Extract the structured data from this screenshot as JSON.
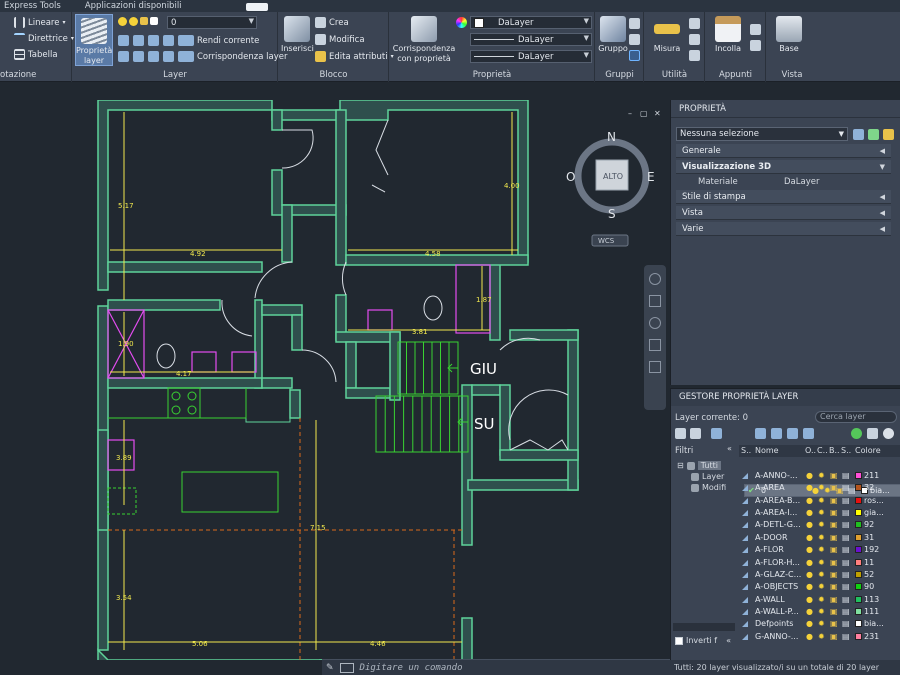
{
  "menu": {
    "items": [
      "Express Tools",
      "Applicazioni disponibili"
    ]
  },
  "ribbon": {
    "annotazione": {
      "items": [
        "Lineare",
        "Direttrice",
        "Tabella"
      ],
      "title": "otazione"
    },
    "layer": {
      "big_button": "Proprietà layer",
      "combo_value": "0",
      "items": [
        "Rendi corrente",
        "Corrispondenza layer"
      ],
      "title": "Layer"
    },
    "blocco": {
      "big_button": "Inserisci",
      "items": [
        "Crea",
        "Modifica",
        "Edita attributi"
      ],
      "title": "Blocco"
    },
    "proprieta": {
      "big_button": "Corrispondenza con proprietà",
      "combos": [
        "DaLayer",
        "DaLayer",
        "DaLayer"
      ],
      "title": "Proprietà"
    },
    "gruppi": {
      "big_button": "Gruppo",
      "title": "Gruppi"
    },
    "utilita": {
      "big_button": "Misura",
      "title": "Utilità"
    },
    "appunti": {
      "big_button": "Incolla",
      "title": "Appunti"
    },
    "vista": {
      "big_button": "Base",
      "title": "Vista"
    }
  },
  "viewcube": {
    "north": "N",
    "south": "S",
    "east": "E",
    "west": "O",
    "face": "ALTO",
    "wcs": "WCS"
  },
  "drawing": {
    "dims": [
      "5.17",
      "4.92",
      "4.00",
      "4.58",
      "1.87",
      "3.81",
      "1.90",
      "4.17",
      "3.89",
      "7.15",
      "3.54",
      "5.06",
      "4.46"
    ],
    "stair_up": "GIU",
    "stair_down": "SU"
  },
  "properties": {
    "title": "PROPRIETÀ",
    "selection": "Nessuna selezione",
    "sections": [
      "Generale",
      "Visualizzazione 3D",
      "Stile di stampa",
      "Vista",
      "Varie"
    ],
    "material_label": "Materiale",
    "material_value": "DaLayer"
  },
  "layer_manager": {
    "title": "GESTORE PROPRIETÀ LAYER",
    "current_layer": "Layer corrente: 0",
    "search_placeholder": "Cerca layer",
    "filters_label": "Filtri",
    "tree": [
      "Tutti",
      "Layer",
      "Modifi"
    ],
    "invert_label": "Inverti f",
    "columns": [
      "S..",
      "Nome",
      "O..",
      "C..",
      "B..",
      "S..",
      "Colore"
    ],
    "rows": [
      {
        "name": "0",
        "color_name": "bia...",
        "color": "#ffffff"
      },
      {
        "name": "A-ANNO-...",
        "color_name": "211",
        "color": "#ff4fd8"
      },
      {
        "name": "A-AREA",
        "color_name": "32",
        "color": "#b3541e"
      },
      {
        "name": "A-AREA-B...",
        "color_name": "ros...",
        "color": "#e81010"
      },
      {
        "name": "A-AREA-I...",
        "color_name": "gia...",
        "color": "#ffff00"
      },
      {
        "name": "A-DETL-G...",
        "color_name": "92",
        "color": "#1fbf1f"
      },
      {
        "name": "A-DOOR",
        "color_name": "31",
        "color": "#e0a030"
      },
      {
        "name": "A-FLOR",
        "color_name": "192",
        "color": "#6a10d0"
      },
      {
        "name": "A-FLOR-H...",
        "color_name": "11",
        "color": "#ff7f7f"
      },
      {
        "name": "A-GLAZ-C...",
        "color_name": "52",
        "color": "#bfa000"
      },
      {
        "name": "A-OBJECTS",
        "color_name": "90",
        "color": "#10d010"
      },
      {
        "name": "A-WALL",
        "color_name": "113",
        "color": "#20c060"
      },
      {
        "name": "A-WALL-P...",
        "color_name": "111",
        "color": "#7fdf9f"
      },
      {
        "name": "Defpoints",
        "color_name": "bia...",
        "color": "#ffffff"
      },
      {
        "name": "G-ANNO-...",
        "color_name": "231",
        "color": "#ff7f9f"
      }
    ],
    "status": "Tutti: 20 layer visualizzato/i su un totale di 20 layer"
  },
  "command": {
    "placeholder": "Digitare un comando"
  },
  "colors": {
    "wall": "#5fd39a",
    "wall_fill": "#2a4a47",
    "dim": "#f2e94e",
    "furn": "#e34cf0",
    "green": "#39d232"
  }
}
